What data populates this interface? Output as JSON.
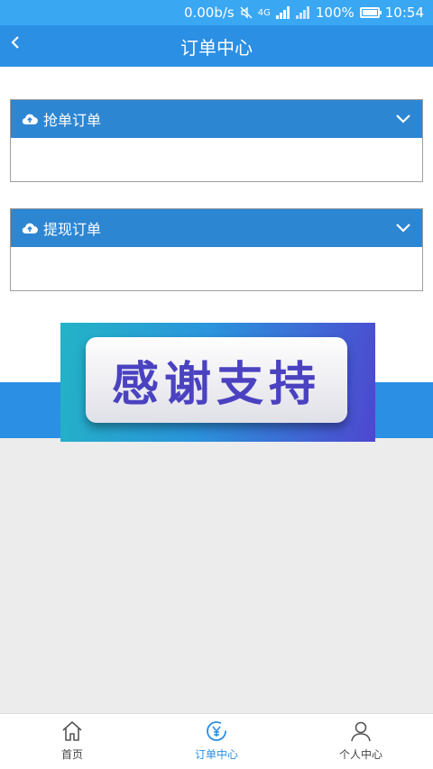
{
  "status_bar": {
    "speed": "0.00b/s",
    "network": "4G",
    "battery": "100%",
    "time": "10:54",
    "battery_level": 1.0
  },
  "header": {
    "back_icon": "chevron-left-icon",
    "title": "订单中心"
  },
  "panels": [
    {
      "label": "抢单订单",
      "icon": "cloud-upload-icon"
    },
    {
      "label": "提现订单",
      "icon": "cloud-upload-icon"
    }
  ],
  "banner": {
    "text": "感谢支持"
  },
  "tabs": [
    {
      "label": "首页",
      "icon": "home-icon"
    },
    {
      "label": "订单中心",
      "icon": "order-icon",
      "active": true
    },
    {
      "label": "个人中心",
      "icon": "user-icon"
    }
  ],
  "colors": {
    "primary": "#2b8fe4",
    "panel_header": "#2d86d2",
    "status_bar": "#3aa7f3",
    "banner_text": "#4a42c0"
  }
}
